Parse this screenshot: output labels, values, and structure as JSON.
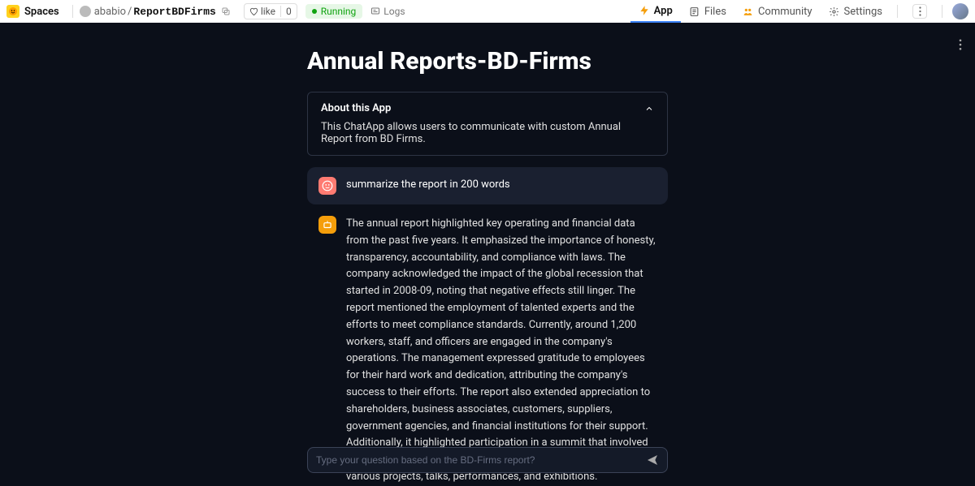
{
  "topbar": {
    "spaces": "Spaces",
    "owner": "ababio",
    "slash": "/",
    "name": "ReportBDFirms",
    "like": "like",
    "like_count": "0",
    "status": "Running",
    "logs": "Logs"
  },
  "tabs": {
    "app": "App",
    "files": "Files",
    "community": "Community",
    "settings": "Settings"
  },
  "page": {
    "title": "Annual Reports-BD-Firms",
    "about_title": "About this App",
    "about_desc": "This ChatApp allows users to communicate with custom Annual Report from BD Firms."
  },
  "chat": {
    "user_msg": "summarize the report in 200 words",
    "bot_msg": "The annual report highlighted key operating and financial data from the past five years. It emphasized the importance of honesty, transparency, accountability, and compliance with laws. The company acknowledged the impact of the global recession that started in 2008-09, noting that negative effects still linger. The report mentioned the employment of talented experts and the efforts to meet compliance standards. Currently, around 1,200 workers, staff, and officers are engaged in the company's operations. The management expressed gratitude to employees for their hard work and dedication, attributing the company's success to their efforts. The report also extended appreciation to shareholders, business associates, customers, suppliers, government agencies, and financial institutions for their support. Additionally, it highlighted participation in a summit that involved curators, writers, and international institutions, showcasing various projects, talks, performances, and exhibitions."
  },
  "input": {
    "placeholder": "Type your question based on the BD-Firms report?"
  }
}
